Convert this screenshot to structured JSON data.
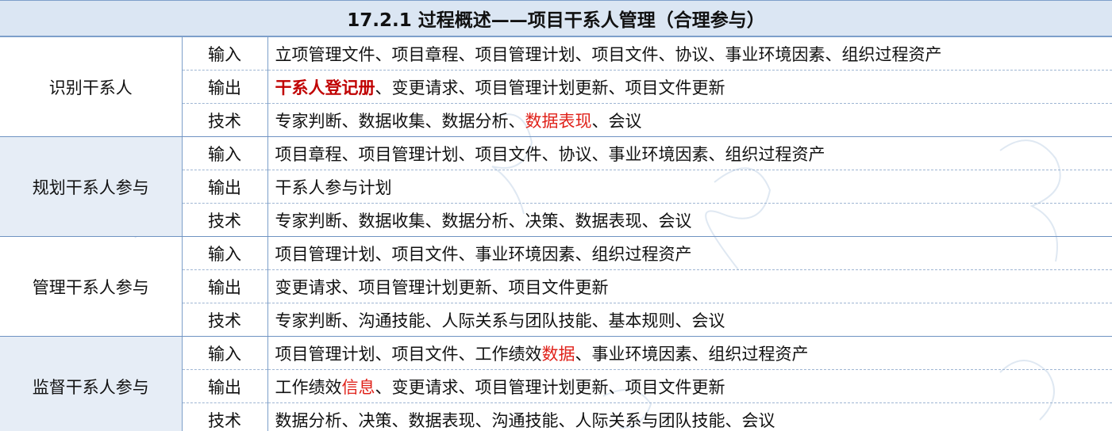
{
  "title": "17.2.1 过程概述——项目干系人管理（合理参与）",
  "groups": [
    {
      "name": "识别干系人",
      "rows": [
        {
          "kind": "输入",
          "segments": [
            {
              "text": "立项管理文件、项目章程、项目管理计划、项目文件、协议、事业环境因素、组织过程资产",
              "style": "normal"
            }
          ]
        },
        {
          "kind": "输出",
          "segments": [
            {
              "text": "干系人登记册",
              "style": "red-bold"
            },
            {
              "text": "、变更请求、项目管理计划更新、项目文件更新",
              "style": "normal"
            }
          ]
        },
        {
          "kind": "技术",
          "segments": [
            {
              "text": "专家判断、数据收集、数据分析、",
              "style": "normal"
            },
            {
              "text": "数据表现",
              "style": "red"
            },
            {
              "text": "、会议",
              "style": "normal"
            }
          ]
        }
      ]
    },
    {
      "name": "规划干系人参与",
      "rows": [
        {
          "kind": "输入",
          "segments": [
            {
              "text": "项目章程、项目管理计划、项目文件、协议、事业环境因素、组织过程资产",
              "style": "normal"
            }
          ]
        },
        {
          "kind": "输出",
          "segments": [
            {
              "text": "干系人参与计划",
              "style": "normal"
            }
          ]
        },
        {
          "kind": "技术",
          "segments": [
            {
              "text": "专家判断、数据收集、数据分析、决策、数据表现、会议",
              "style": "normal"
            }
          ]
        }
      ]
    },
    {
      "name": "管理干系人参与",
      "rows": [
        {
          "kind": "输入",
          "segments": [
            {
              "text": "项目管理计划、项目文件、事业环境因素、组织过程资产",
              "style": "normal"
            }
          ]
        },
        {
          "kind": "输出",
          "segments": [
            {
              "text": "变更请求、项目管理计划更新、项目文件更新",
              "style": "normal"
            }
          ]
        },
        {
          "kind": "技术",
          "segments": [
            {
              "text": "专家判断、沟通技能、人际关系与团队技能、基本规则、会议",
              "style": "normal"
            }
          ]
        }
      ]
    },
    {
      "name": "监督干系人参与",
      "rows": [
        {
          "kind": "输入",
          "segments": [
            {
              "text": "项目管理计划、项目文件、工作绩效",
              "style": "normal"
            },
            {
              "text": "数据",
              "style": "red"
            },
            {
              "text": "、事业环境因素、组织过程资产",
              "style": "normal"
            }
          ]
        },
        {
          "kind": "输出",
          "segments": [
            {
              "text": "工作绩效",
              "style": "normal"
            },
            {
              "text": "信息",
              "style": "red"
            },
            {
              "text": "、变更请求、项目管理计划更新、项目文件更新",
              "style": "normal"
            }
          ]
        },
        {
          "kind": "技术",
          "segments": [
            {
              "text": "数据分析、决策、数据表现、沟通技能、人际关系与团队技能、会议",
              "style": "normal"
            }
          ]
        }
      ]
    }
  ],
  "colors": {
    "header_bg": "#dbe6f3",
    "group_bg_shaded": "#e6edf6",
    "highlight_red": "#e0221a",
    "highlight_dark_red": "#c00000",
    "border_blue": "#7d9fca"
  }
}
